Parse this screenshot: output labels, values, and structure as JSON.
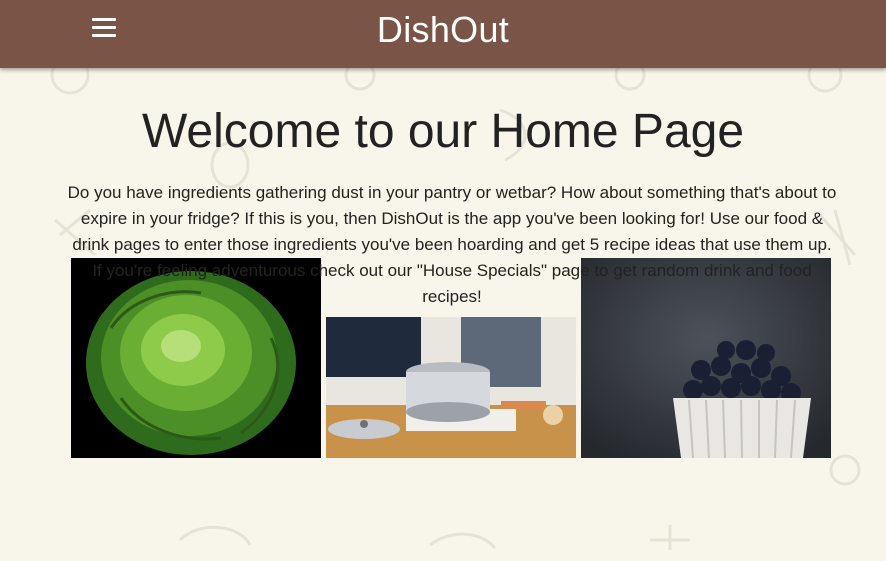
{
  "header": {
    "brand": "DishOut",
    "menu_icon": "hamburger-menu-icon",
    "bg_color": "#7a5446"
  },
  "main": {
    "title": "Welcome to our Home Page",
    "intro": "Do you have ingredients gathering dust in your pantry or wetbar? How about something that's about to expire in your fridge? If this is you, then DishOut is the app you've been looking for! Use our food & drink pages to enter those ingredients you've been hoarding and get 5 recipe ideas that use them up. If you're feeling adventurous check out our \"House Specials\" page to get random drink and food recipes!",
    "images": [
      {
        "subject": "lettuce-head"
      },
      {
        "subject": "cooking-pot"
      },
      {
        "subject": "blueberries-bowl"
      }
    ]
  },
  "colors": {
    "page_background": "#f8f6ea",
    "header": "#7a5446",
    "text": "#222222"
  }
}
